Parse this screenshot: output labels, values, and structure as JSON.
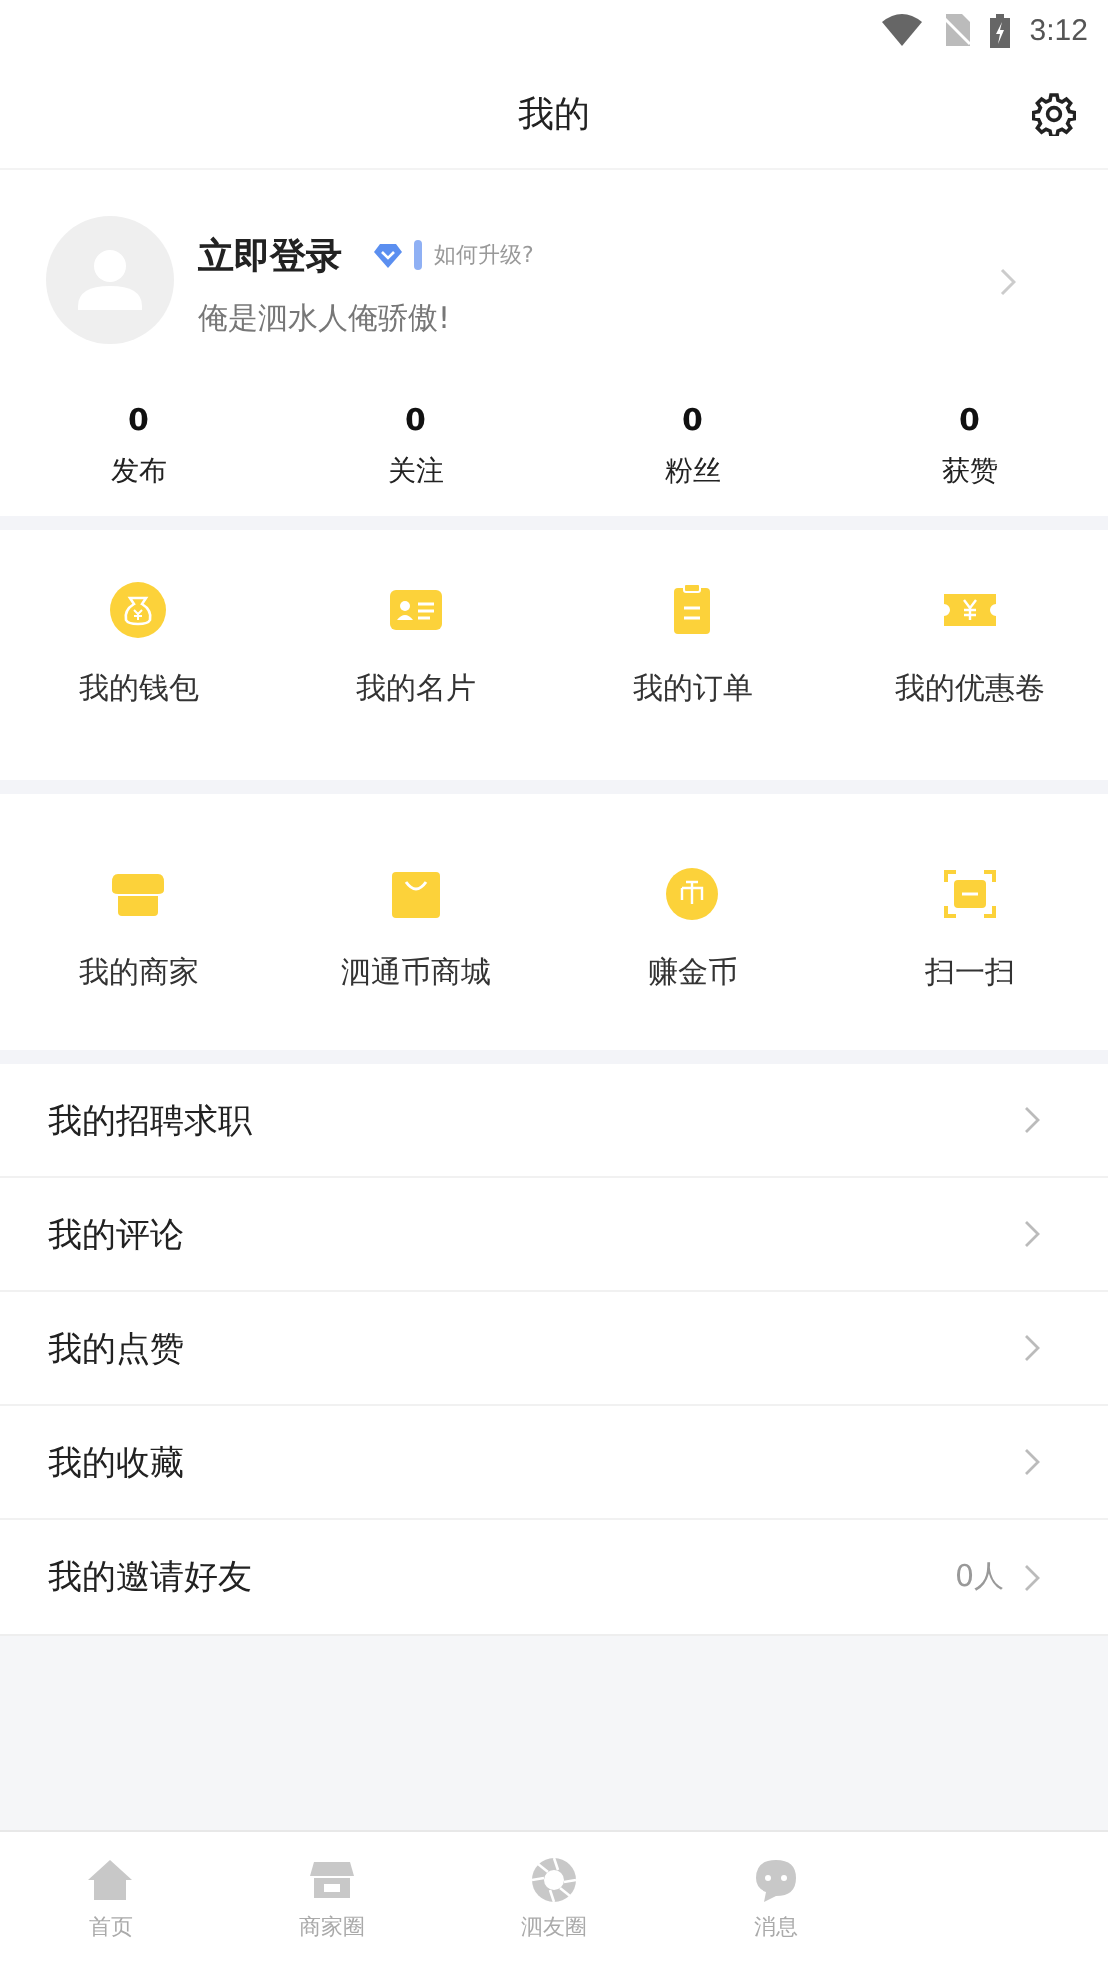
{
  "status_bar": {
    "time": "3:12"
  },
  "header": {
    "title": "我的"
  },
  "profile": {
    "name": "立即登录",
    "upgrade_link": "如何升级?",
    "motto": "俺是泗水人俺骄傲!"
  },
  "stats": [
    {
      "value": "0",
      "label": "发布"
    },
    {
      "value": "0",
      "label": "关注"
    },
    {
      "value": "0",
      "label": "粉丝"
    },
    {
      "value": "0",
      "label": "获赞"
    }
  ],
  "grids": [
    [
      {
        "kind": "wallet",
        "label": "我的钱包"
      },
      {
        "kind": "card",
        "label": "我的名片"
      },
      {
        "kind": "order",
        "label": "我的订单"
      },
      {
        "kind": "coupon",
        "label": "我的优惠卷"
      }
    ],
    [
      {
        "kind": "shop",
        "label": "我的商家"
      },
      {
        "kind": "bag",
        "label": "泗通币商城"
      },
      {
        "kind": "coin",
        "label": "赚金币"
      },
      {
        "kind": "scan",
        "label": "扫一扫"
      }
    ]
  ],
  "menu": [
    {
      "label": "我的招聘求职"
    },
    {
      "label": "我的评论"
    },
    {
      "label": "我的点赞"
    },
    {
      "label": "我的收藏"
    },
    {
      "label": "我的邀请好友",
      "value": "0人"
    }
  ],
  "tab_bar": [
    {
      "kind": "home",
      "label": "首页",
      "selected": false
    },
    {
      "kind": "shop",
      "label": "商家圈",
      "selected": false
    },
    {
      "kind": "aperture",
      "label": "泗友圈",
      "selected": false
    },
    {
      "kind": "chat",
      "label": "消息",
      "selected": false
    }
  ]
}
